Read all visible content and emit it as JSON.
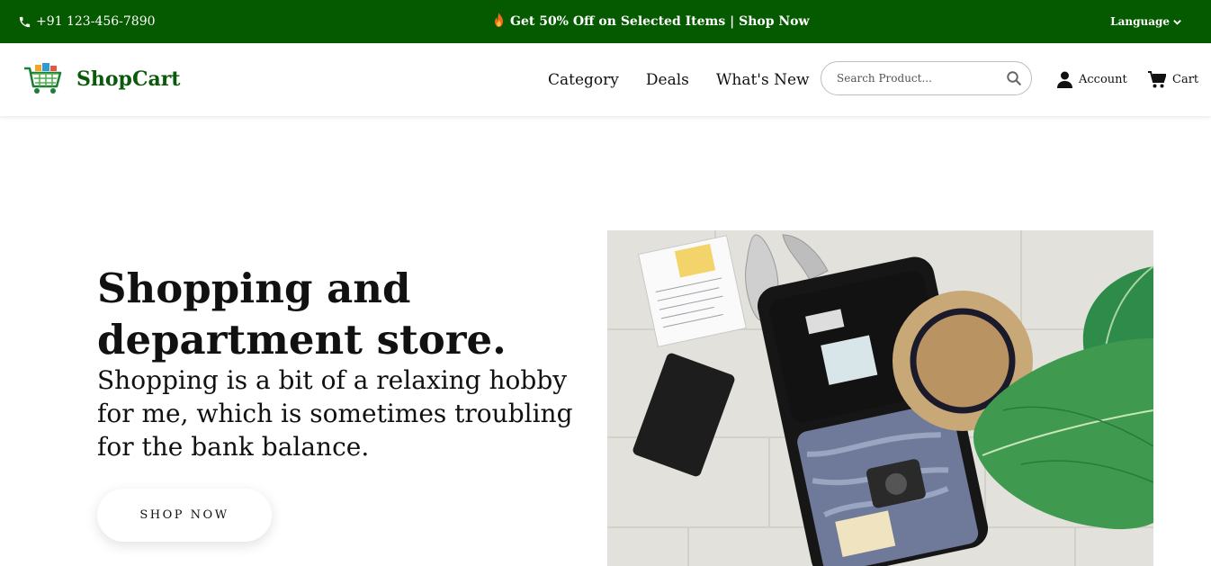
{
  "topbar": {
    "phone": "+91 123-456-7890",
    "promo_icon": "fire-icon",
    "promo": "Get 50% Off on Selected Items | Shop Now",
    "language": "Language"
  },
  "header": {
    "brand": "ShopCart",
    "nav": [
      "Category",
      "Deals",
      "What's New"
    ],
    "search_placeholder": "Search Product...",
    "account": "Account",
    "cart": "Cart"
  },
  "hero": {
    "title": "Shopping and department store.",
    "text": "Shopping is a bit of a relaxing hobby for me, which is sometimes troubling for the bank balance.",
    "button": "SHOP NOW"
  },
  "colors": {
    "topbar_bg": "#055a00",
    "brand": "#0b5a0b"
  }
}
